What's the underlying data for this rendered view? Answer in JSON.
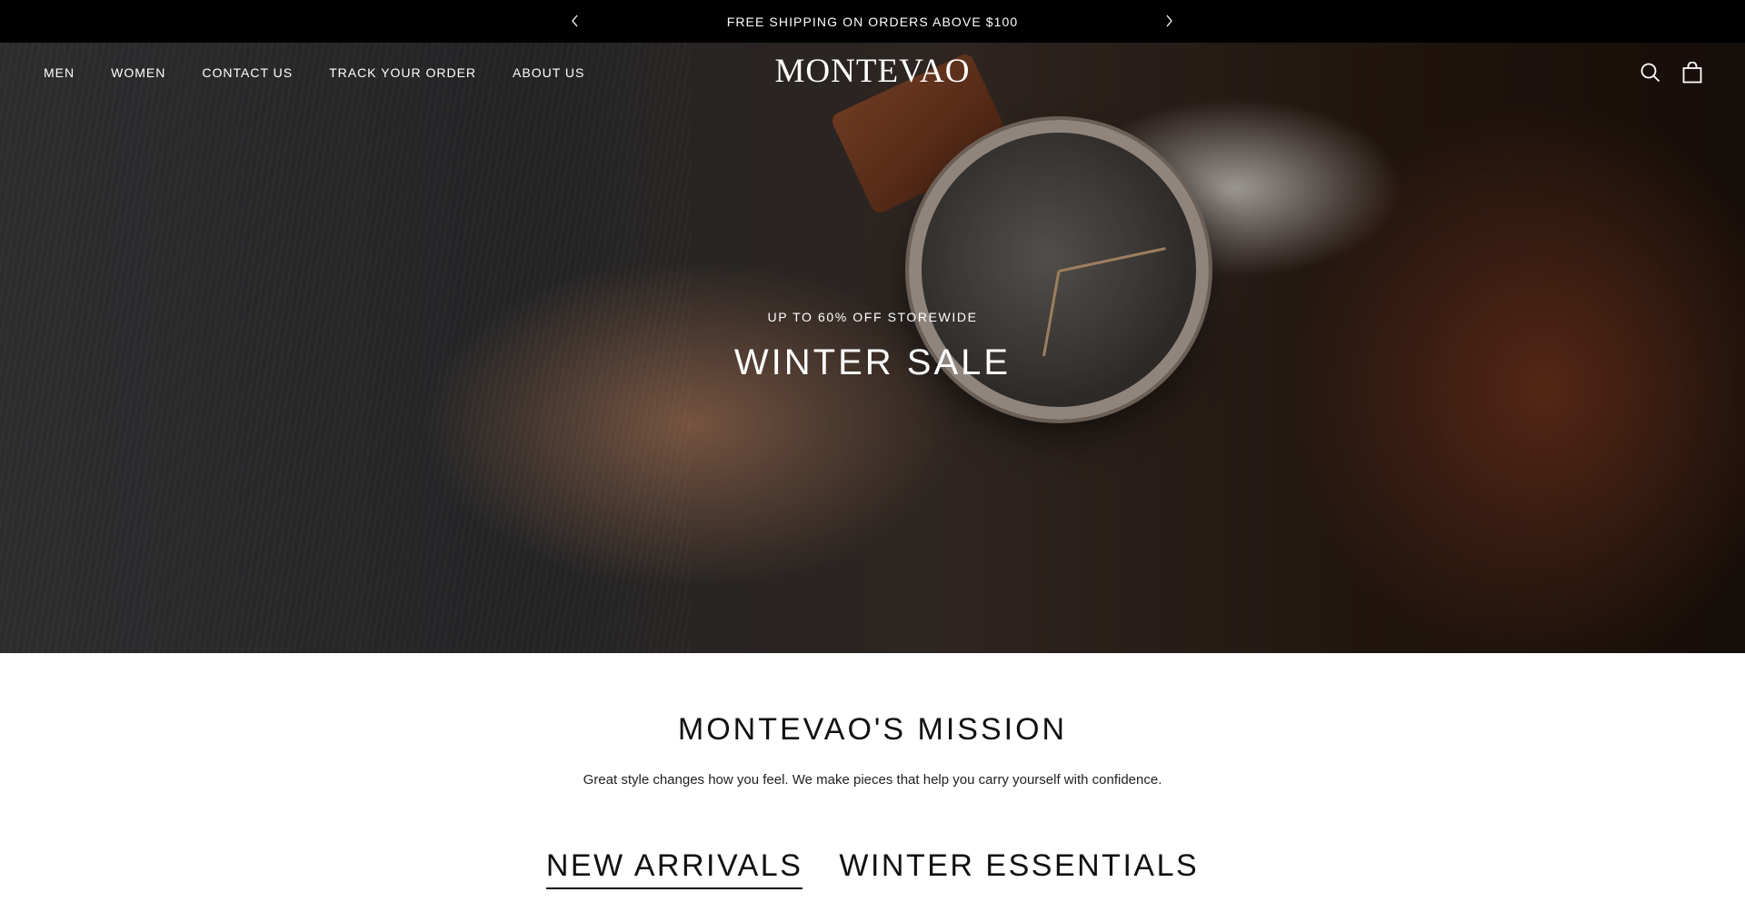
{
  "announcement": {
    "text": "FREE SHIPPING ON ORDERS ABOVE $100",
    "prev_icon": "chevron-left-icon",
    "next_icon": "chevron-right-icon"
  },
  "header": {
    "logo": "MONTEVAO",
    "nav": [
      {
        "label": "MEN"
      },
      {
        "label": "WOMEN"
      },
      {
        "label": "CONTACT US"
      },
      {
        "label": "TRACK YOUR ORDER"
      },
      {
        "label": "ABOUT US"
      }
    ],
    "icons": [
      "search-icon",
      "shopping-bag-icon"
    ]
  },
  "hero": {
    "subtitle": "UP TO 60% OFF STOREWIDE",
    "title": "WINTER SALE"
  },
  "mission": {
    "title": "MONTEVAO'S MISSION",
    "text": "Great style changes how you feel. We make pieces that help you carry yourself with confidence."
  },
  "collections": {
    "tabs": [
      {
        "label": "NEW ARRIVALS",
        "active": true
      },
      {
        "label": "WINTER ESSENTIALS",
        "active": false
      }
    ]
  },
  "colors": {
    "announcement_bg": "#000000",
    "text_light": "#ffffff",
    "text_dark": "#111111"
  }
}
